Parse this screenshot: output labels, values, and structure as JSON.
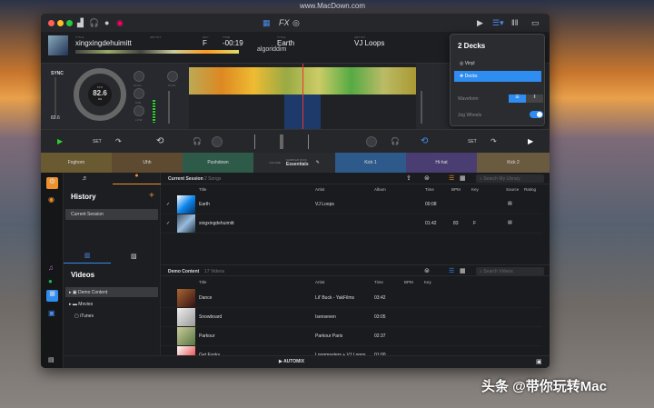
{
  "watermarks": {
    "top": "www.MacDown.com",
    "bottom": "头条 @带你玩转Mac"
  },
  "deckA": {
    "title_label": "TITLE",
    "title": "xingxingdehuimitt",
    "artist_label": "ARTIST",
    "key_label": "KEY",
    "key": "F",
    "time_label": "TIME",
    "time": "-00:19",
    "sync": "SYNC",
    "bpm_label": "BPM",
    "bpm": "82.6",
    "pitch": "0%",
    "pitch_value": "82.6",
    "knobs": [
      "HIGH",
      "MID",
      "LOW"
    ],
    "gain": "GAIN"
  },
  "deckB": {
    "title_label": "TITLE",
    "title": "Earth",
    "artist_label": "ARTIST",
    "artist": "VJ Loops"
  },
  "logo": "algoriddim",
  "fx": "FX",
  "menu": {
    "title": "2 Decks",
    "items": [
      {
        "label": "Vinyl",
        "icon": "vinyl-icon"
      },
      {
        "label": "Decks",
        "icon": "decks-icon",
        "selected": true
      }
    ],
    "waveform_label": "Waveform",
    "jog_label": "Jog Wheels",
    "jog_on": true
  },
  "controls": {
    "set": "SET",
    "set2": "SET"
  },
  "pads": {
    "left": [
      "Foghorn",
      "Uhh",
      "Pushdown"
    ],
    "right": [
      "Kick 1",
      "Hi-hat",
      "Kick 2"
    ],
    "sampler_label": "SAMPLER PACK",
    "sampler": "Essentials",
    "volume": "VOLUME"
  },
  "sidebar": {
    "history_title": "History",
    "history_items": [
      "Current Session"
    ],
    "videos_title": "Videos",
    "video_items": [
      "Demo Content",
      "Movies",
      "iTunes"
    ]
  },
  "session": {
    "title": "Current Session",
    "count": "2 Songs",
    "search_placeholder": "Search My Library",
    "columns": [
      "Title",
      "Artist",
      "Album",
      "Time",
      "BPM",
      "Key",
      "Source",
      "Rating"
    ],
    "rows": [
      {
        "title": "Earth",
        "artist": "VJ Loops",
        "album": "",
        "time": "00:08",
        "bpm": "",
        "key": ""
      },
      {
        "title": "xingxingdehuimitt",
        "artist": "",
        "album": "",
        "time": "01:42",
        "bpm": "83",
        "key": "F"
      }
    ]
  },
  "videos": {
    "title": "Demo Content",
    "count": "17 Videos",
    "search_placeholder": "Search Videos",
    "columns": [
      "Title",
      "Artist",
      "Time",
      "BPM",
      "Key"
    ],
    "rows": [
      {
        "title": "Dance",
        "artist": "Lil' Buck - YakFilms",
        "time": "03:42"
      },
      {
        "title": "Snowboard",
        "artist": "Isenseven",
        "time": "03:05"
      },
      {
        "title": "Parkour",
        "artist": "Parkour Paris",
        "time": "02:37"
      },
      {
        "title": "Get Funky",
        "artist": "Loopmasters + VJ Loops",
        "time": "01:00"
      }
    ]
  },
  "automix": "AUTOMIX",
  "colors": {
    "accent": "#f0922b",
    "blue": "#2f8cf0"
  }
}
